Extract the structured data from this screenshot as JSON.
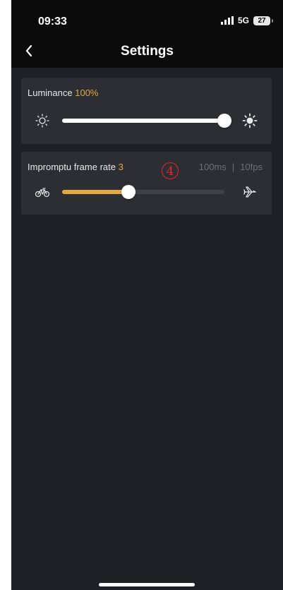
{
  "status": {
    "time": "09:33",
    "network": "5G",
    "battery": "27"
  },
  "header": {
    "title": "Settings",
    "back_icon": "chevron-left-icon"
  },
  "luminance": {
    "label": "Luminance",
    "value": "100%",
    "level": 1.0,
    "left_icon": "sun-dim-icon",
    "right_icon": "sun-bright-icon"
  },
  "frame_rate": {
    "label": "Impromptu frame rate",
    "value": "3",
    "level": 0.41,
    "interval": "100ms",
    "separator": "|",
    "fps": "10fps",
    "left_icon": "bicycle-icon",
    "right_icon": "airplane-icon"
  },
  "annotation": {
    "marker": "4"
  },
  "colors": {
    "accent": "#e2a841",
    "background": "#1e2026",
    "card": "#2c2e33",
    "marker": "#e8262b"
  }
}
